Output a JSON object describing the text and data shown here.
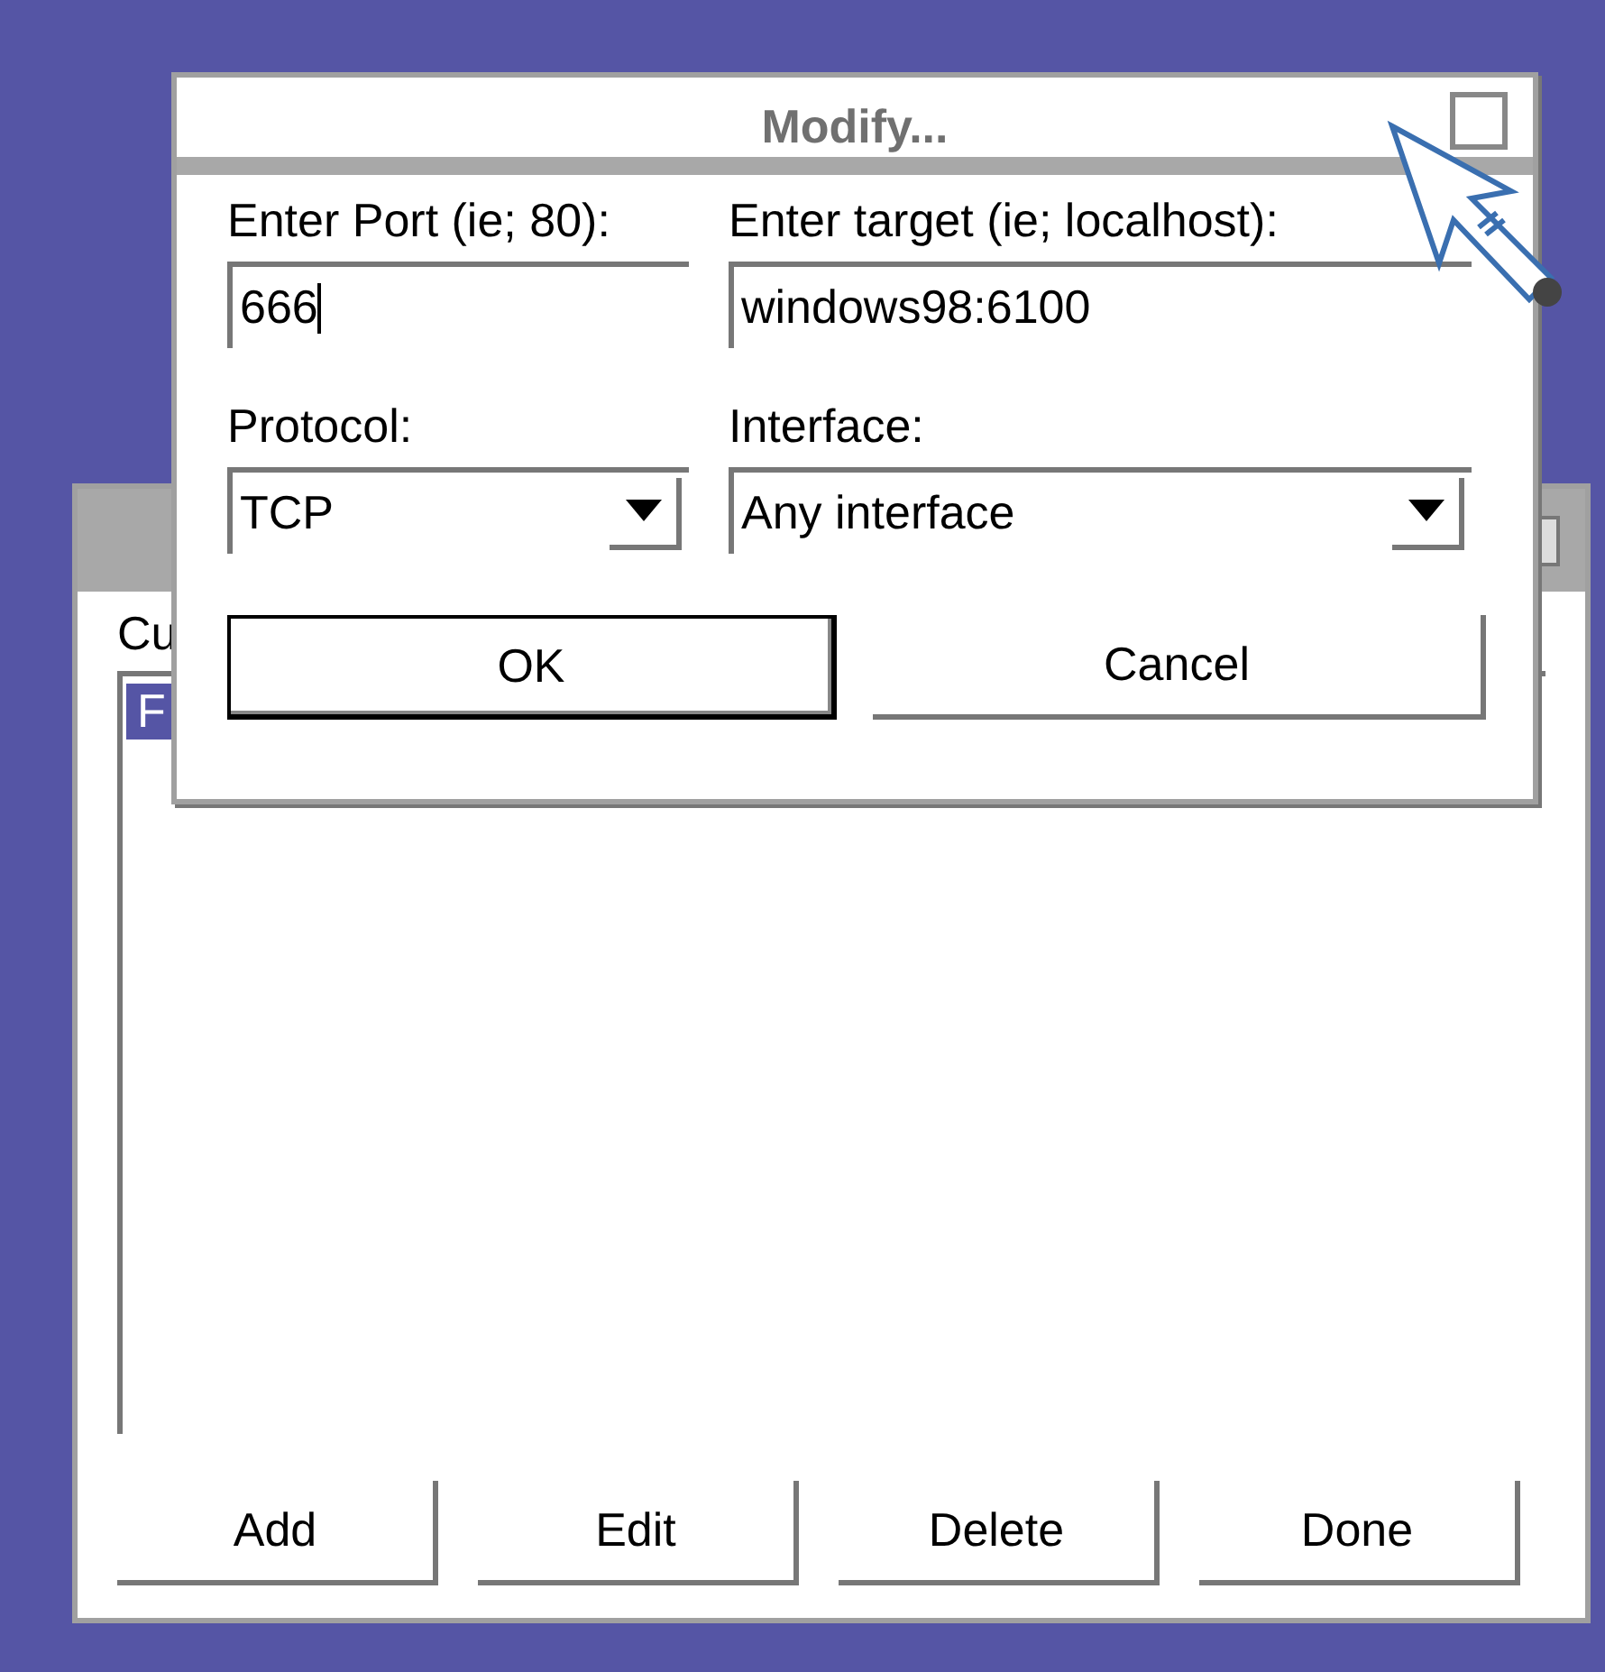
{
  "main_window": {
    "label": "Cu",
    "list": [
      {
        "text": "F",
        "selected": true
      }
    ],
    "buttons": [
      "Add",
      "Edit",
      "Delete",
      "Done"
    ]
  },
  "dialog": {
    "title": "Modify...",
    "fields": [
      {
        "kind": "text",
        "label": "Enter Port (ie; 80):",
        "value": "666",
        "focused": true
      },
      {
        "kind": "text",
        "label": "Enter target (ie; localhost):",
        "value": "windows98:6100"
      },
      {
        "kind": "select",
        "label": "Protocol:",
        "value": "TCP"
      },
      {
        "kind": "select",
        "label": "Interface:",
        "value": "Any interface"
      }
    ],
    "buttons": [
      {
        "label": "OK",
        "default": true
      },
      {
        "label": "Cancel",
        "default": false
      }
    ]
  }
}
